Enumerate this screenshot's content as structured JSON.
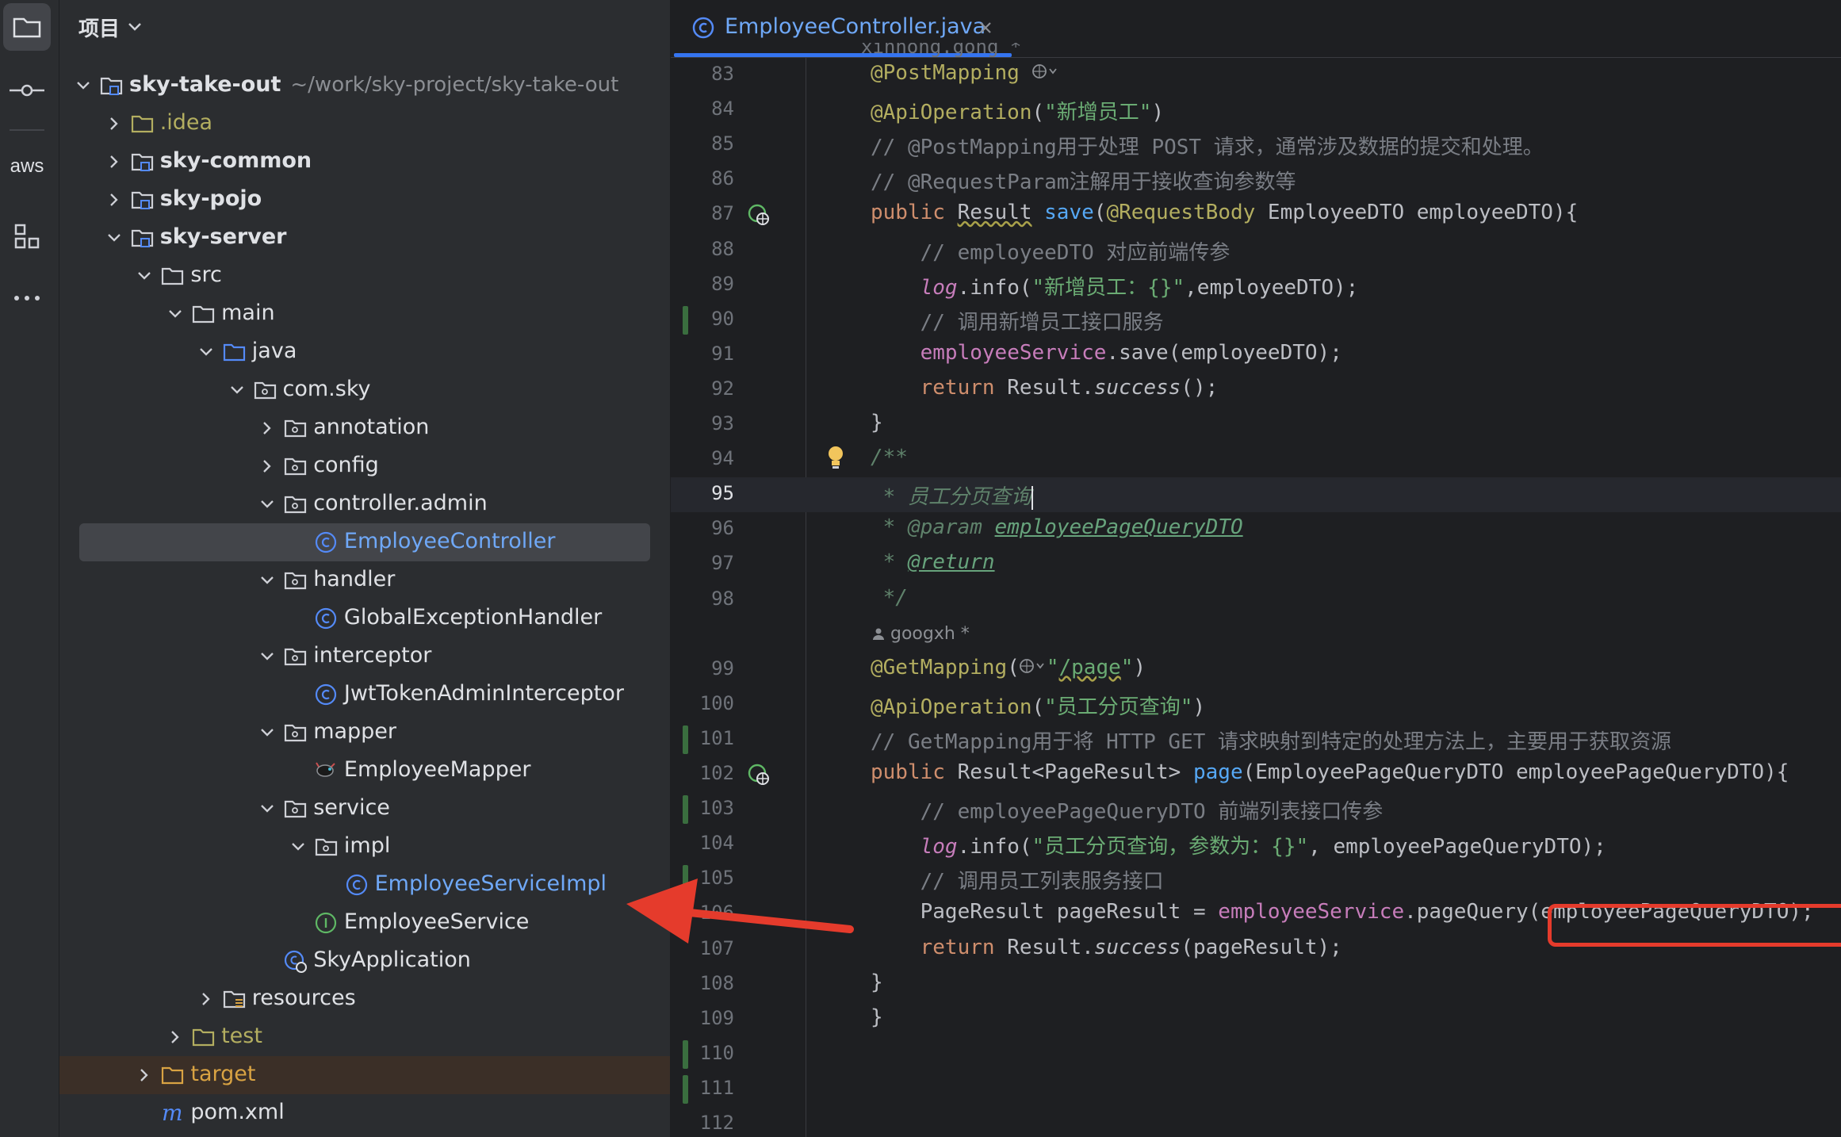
{
  "activity_bar": {
    "items": [
      {
        "name": "project",
        "label": ""
      },
      {
        "name": "commit",
        "label": ""
      },
      {
        "name": "aws",
        "label": "aws"
      },
      {
        "name": "structure",
        "label": ""
      },
      {
        "name": "more",
        "label": ""
      }
    ]
  },
  "project_panel": {
    "title": "项目",
    "tree": [
      {
        "label": "sky-take-out",
        "path": "~/work/sky-project/sky-take-out",
        "icon": "module-folder-icon",
        "expanded": true,
        "bold": true
      },
      {
        "label": ".idea",
        "icon": "folder-icon",
        "expanded": false,
        "color": "#b3ae60"
      },
      {
        "label": "sky-common",
        "icon": "module-folder-icon",
        "expanded": false,
        "bold": true
      },
      {
        "label": "sky-pojo",
        "icon": "module-folder-icon",
        "expanded": false,
        "bold": true
      },
      {
        "label": "sky-server",
        "icon": "module-folder-icon",
        "expanded": true,
        "bold": true
      },
      {
        "label": "src",
        "icon": "folder-icon",
        "expanded": true
      },
      {
        "label": "main",
        "icon": "folder-icon",
        "expanded": true
      },
      {
        "label": "java",
        "icon": "source-folder-icon",
        "expanded": true
      },
      {
        "label": "com.sky",
        "icon": "package-icon",
        "expanded": true
      },
      {
        "label": "annotation",
        "icon": "package-icon",
        "expanded": false
      },
      {
        "label": "config",
        "icon": "package-icon",
        "expanded": false
      },
      {
        "label": "controller.admin",
        "icon": "package-icon",
        "expanded": true
      },
      {
        "label": "EmployeeController",
        "icon": "class-icon",
        "color": "#6fa8f7",
        "selected": true
      },
      {
        "label": "handler",
        "icon": "package-icon",
        "expanded": true
      },
      {
        "label": "GlobalExceptionHandler",
        "icon": "class-icon"
      },
      {
        "label": "interceptor",
        "icon": "package-icon",
        "expanded": true
      },
      {
        "label": "JwtTokenAdminInterceptor",
        "icon": "class-icon"
      },
      {
        "label": "mapper",
        "icon": "package-icon",
        "expanded": true
      },
      {
        "label": "EmployeeMapper",
        "icon": "mybatis-icon"
      },
      {
        "label": "service",
        "icon": "package-icon",
        "expanded": true
      },
      {
        "label": "impl",
        "icon": "package-icon",
        "expanded": true
      },
      {
        "label": "EmployeeServiceImpl",
        "icon": "class-icon",
        "color": "#6fa8f7"
      },
      {
        "label": "EmployeeService",
        "icon": "interface-icon"
      },
      {
        "label": "SkyApplication",
        "icon": "spring-boot-class-icon"
      },
      {
        "label": "resources",
        "icon": "resources-folder-icon",
        "expanded": false
      },
      {
        "label": "test",
        "icon": "folder-icon",
        "expanded": false,
        "color": "#b3ae60"
      },
      {
        "label": "target",
        "icon": "excluded-folder-icon",
        "expanded": false,
        "color": "#d9a343",
        "excluded": true
      },
      {
        "label": "pom.xml",
        "icon": "maven-icon"
      }
    ]
  },
  "editor": {
    "tab_title": "EmployeeController.java",
    "top_partial": "xinhong.gong *",
    "author_inlay": "googxh *",
    "colors": {
      "accent": "#3574f0",
      "annotation": "#b3ae60",
      "keyword": "#cf8e6d",
      "string": "#6aab73",
      "highlight_box": "#e53b2c"
    },
    "lines": [
      {
        "n": "83",
        "t": [
          [
            "ann",
            "@PostMapping"
          ]
        ]
      },
      {
        "n": "84",
        "t": [
          [
            "ann",
            "@ApiOperation"
          ],
          [
            "",
            "("
          ],
          [
            "str",
            "\"新增员工\""
          ],
          [
            "",
            ")"
          ]
        ]
      },
      {
        "n": "85",
        "t": [
          [
            "cmt",
            "// @PostMapping用于处理 POST 请求，通常涉及数据的提交和处理。"
          ]
        ]
      },
      {
        "n": "86",
        "t": [
          [
            "cmt",
            "// @RequestParam注解用于接收查询参数等"
          ]
        ]
      },
      {
        "n": "87",
        "t": [
          [
            "kw",
            "public "
          ],
          [
            "sq",
            "Result"
          ],
          [
            "",
            " "
          ],
          [
            "fn",
            "save"
          ],
          [
            "",
            "("
          ],
          [
            "ann",
            "@RequestBody"
          ],
          [
            "",
            " EmployeeDTO employeeDTO){"
          ]
        ]
      },
      {
        "n": "88",
        "t": [
          [
            "cmt",
            "    // employeeDTO 对应前端传参"
          ]
        ]
      },
      {
        "n": "89",
        "t": [
          [
            "",
            "    "
          ],
          [
            "fld it",
            "log"
          ],
          [
            "",
            ".info("
          ],
          [
            "str",
            "\"新增员工：{}\""
          ],
          [
            "",
            ",employeeDTO);"
          ]
        ]
      },
      {
        "n": "90",
        "t": [
          [
            "cmt",
            "    // 调用新增员工接口服务"
          ]
        ]
      },
      {
        "n": "91",
        "t": [
          [
            "",
            "    "
          ],
          [
            "fld",
            "employeeService"
          ],
          [
            "",
            ".save(employeeDTO);"
          ]
        ]
      },
      {
        "n": "92",
        "t": [
          [
            "kw",
            "    return "
          ],
          [
            "",
            "Result."
          ],
          [
            "it",
            "success"
          ],
          [
            "",
            "();"
          ]
        ]
      },
      {
        "n": "93",
        "t": [
          [
            "",
            "}"
          ]
        ]
      },
      {
        "n": "94",
        "t": [
          [
            "doc",
            "/**"
          ]
        ]
      },
      {
        "n": "95",
        "t": [
          [
            "doc",
            " * 员工分页查询"
          ]
        ]
      },
      {
        "n": "96",
        "t": [
          [
            "doc",
            " * "
          ],
          [
            "doc",
            "@param "
          ],
          [
            "doctag",
            "employeePageQueryDTO"
          ]
        ]
      },
      {
        "n": "97",
        "t": [
          [
            "doc",
            " * "
          ],
          [
            "doctag",
            "@return"
          ]
        ]
      },
      {
        "n": "98",
        "t": [
          [
            "doc",
            " */"
          ]
        ]
      },
      {
        "n": "",
        "t": []
      },
      {
        "n": "99",
        "t": [
          [
            "ann",
            "@GetMapping"
          ],
          [
            "",
            "("
          ],
          [
            "str",
            "\""
          ],
          [
            "str sq",
            "/page"
          ],
          [
            "str",
            "\""
          ],
          [
            "",
            ")"
          ]
        ]
      },
      {
        "n": "100",
        "t": [
          [
            "ann",
            "@ApiOperation"
          ],
          [
            "",
            "("
          ],
          [
            "str",
            "\"员工分页查询\""
          ],
          [
            "",
            ")"
          ]
        ]
      },
      {
        "n": "101",
        "t": [
          [
            "cmt",
            "// GetMapping用于将 HTTP GET 请求映射到特定的处理方法上，主要用于获取资源"
          ]
        ]
      },
      {
        "n": "102",
        "t": [
          [
            "kw",
            "public "
          ],
          [
            "",
            "Result<PageResult> "
          ],
          [
            "fn",
            "page"
          ],
          [
            "",
            "(EmployeePageQueryDTO employeePageQueryDTO){"
          ]
        ]
      },
      {
        "n": "103",
        "t": [
          [
            "cmt",
            "    // employeePageQueryDTO 前端列表接口传参"
          ]
        ]
      },
      {
        "n": "104",
        "t": [
          [
            "",
            "    "
          ],
          [
            "fld it",
            "log"
          ],
          [
            "",
            ".info("
          ],
          [
            "str",
            "\"员工分页查询，参数为：{}\""
          ],
          [
            "",
            ", employeePageQueryDTO);"
          ]
        ]
      },
      {
        "n": "105",
        "t": [
          [
            "cmt",
            "    // 调用员工列表服务接口"
          ]
        ]
      },
      {
        "n": "106",
        "t": [
          [
            "",
            "    PageResult pageResult = "
          ],
          [
            "fld",
            "employeeService"
          ],
          [
            "",
            ".pageQuery(employeePageQueryDTO);"
          ]
        ]
      },
      {
        "n": "107",
        "t": [
          [
            "kw",
            "    return "
          ],
          [
            "",
            "Result."
          ],
          [
            "it",
            "success"
          ],
          [
            "",
            "(pageResult);"
          ]
        ]
      },
      {
        "n": "108",
        "t": [
          [
            "",
            "}"
          ]
        ]
      },
      {
        "n": "109",
        "t": [
          [
            "",
            "}"
          ]
        ]
      },
      {
        "n": "110",
        "t": []
      },
      {
        "n": "111",
        "t": []
      },
      {
        "n": "112",
        "t": []
      }
    ]
  }
}
